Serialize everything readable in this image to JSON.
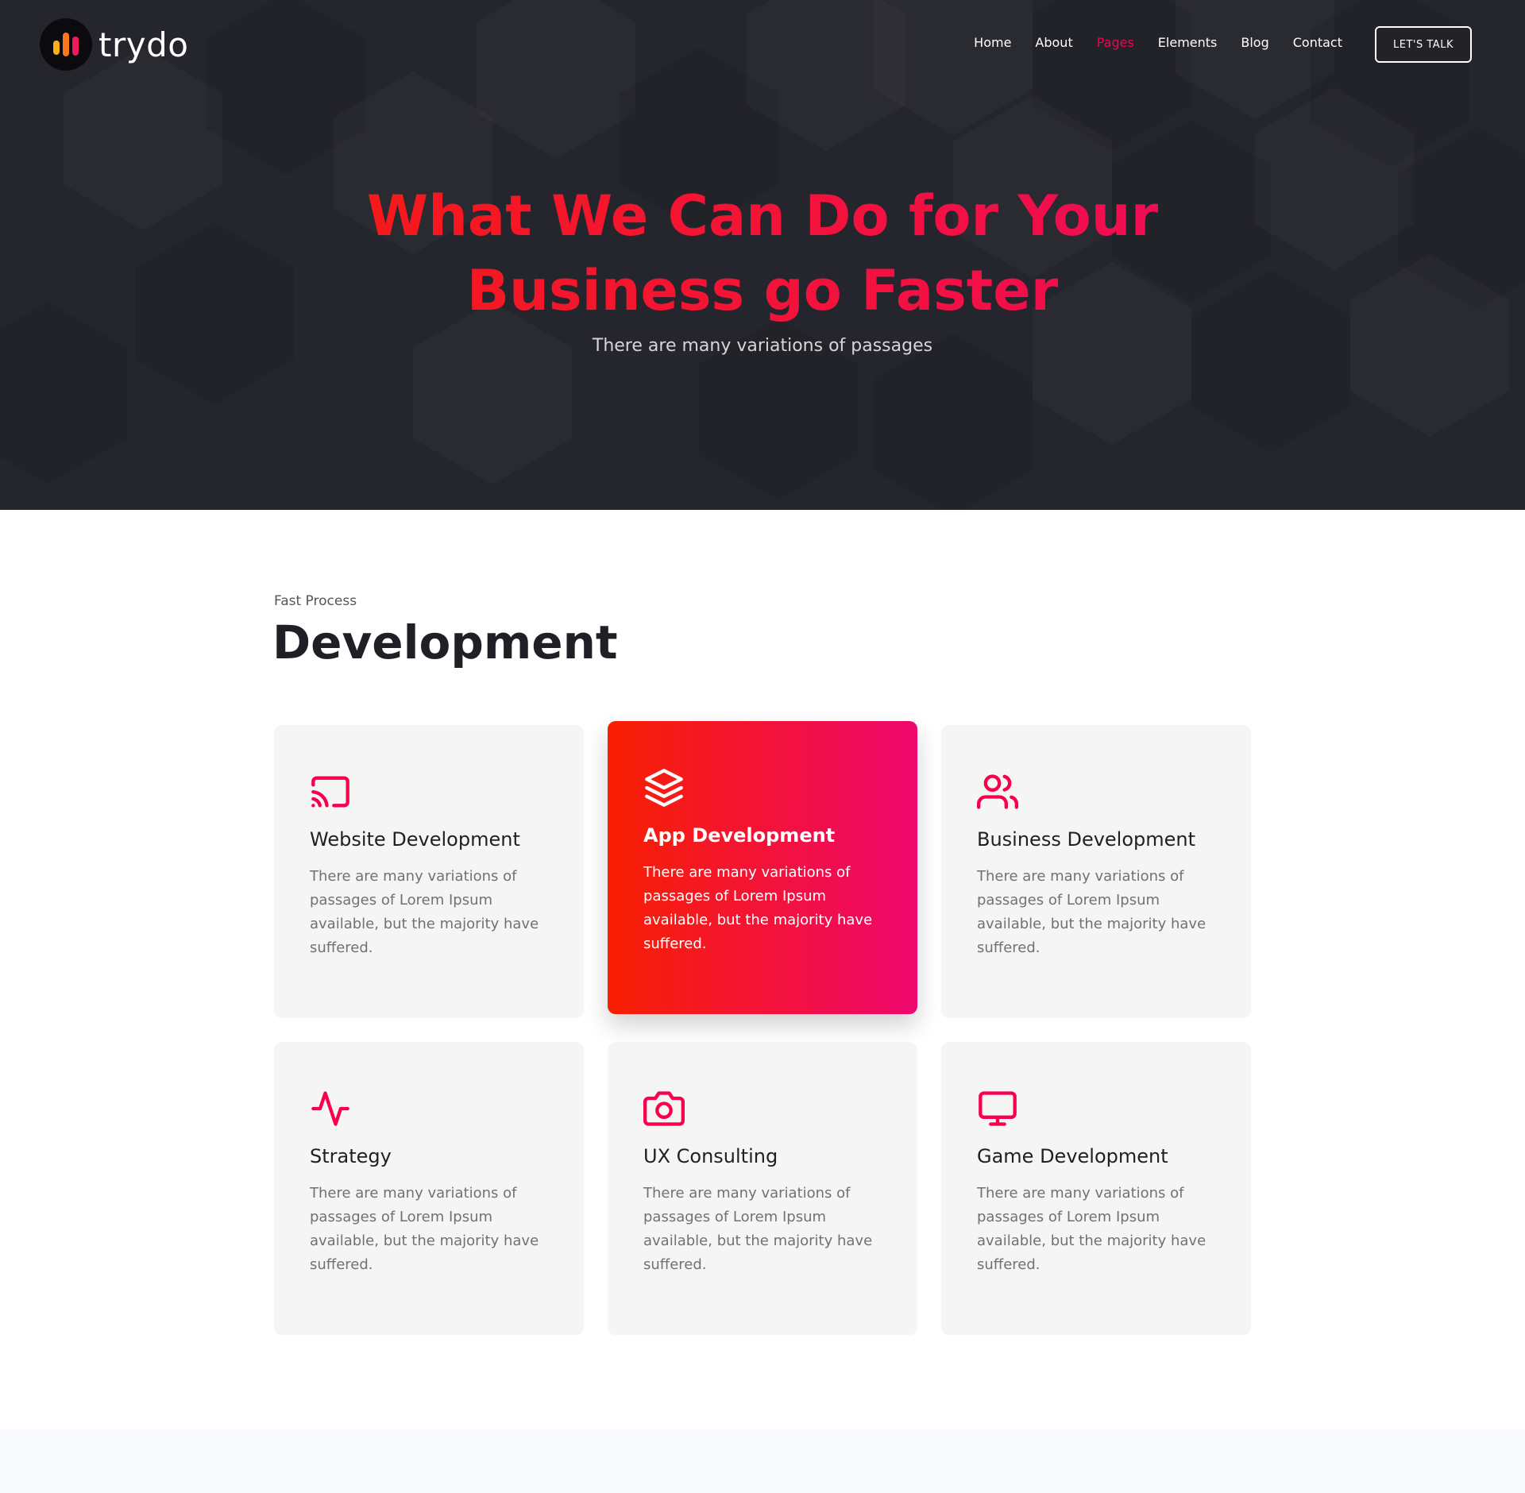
{
  "brand": {
    "name": "trydo",
    "accent": "#f9004d",
    "gradient_start": "#f81f01",
    "gradient_end": "#ee076e"
  },
  "nav": {
    "items": [
      {
        "label": "Home",
        "active": false
      },
      {
        "label": "About",
        "active": false
      },
      {
        "label": "Pages",
        "active": true
      },
      {
        "label": "Elements",
        "active": false
      },
      {
        "label": "Blog",
        "active": false
      },
      {
        "label": "Contact",
        "active": false
      }
    ],
    "cta": "LET'S TALK"
  },
  "hero": {
    "title_line1": "What We Can Do for Your",
    "title_line2": "Business go Faster",
    "subtitle": "There are many variations of passages"
  },
  "services": {
    "subtitle": "Fast Process",
    "title": "Development",
    "cards": [
      {
        "icon": "cast-icon",
        "title": "Website Development",
        "desc": "There are many variations of passages of Lorem Ipsum available, but the majority have suffered.",
        "highlight": false
      },
      {
        "icon": "layers-icon",
        "title": "App Development",
        "desc": "There are many variations of passages of Lorem Ipsum available, but the majority have suffered.",
        "highlight": true
      },
      {
        "icon": "users-icon",
        "title": "Business Development",
        "desc": "There are many variations of passages of Lorem Ipsum available, but the majority have suffered.",
        "highlight": false
      },
      {
        "icon": "activity-icon",
        "title": "Strategy",
        "desc": "There are many variations of passages of Lorem Ipsum available, but the majority have suffered.",
        "highlight": false
      },
      {
        "icon": "camera-icon",
        "title": "UX Consulting",
        "desc": "There are many variations of passages of Lorem Ipsum available, but the majority have suffered.",
        "highlight": false
      },
      {
        "icon": "monitor-icon",
        "title": "Game Development",
        "desc": "There are many variations of passages of Lorem Ipsum available, but the majority have suffered.",
        "highlight": false
      }
    ]
  }
}
